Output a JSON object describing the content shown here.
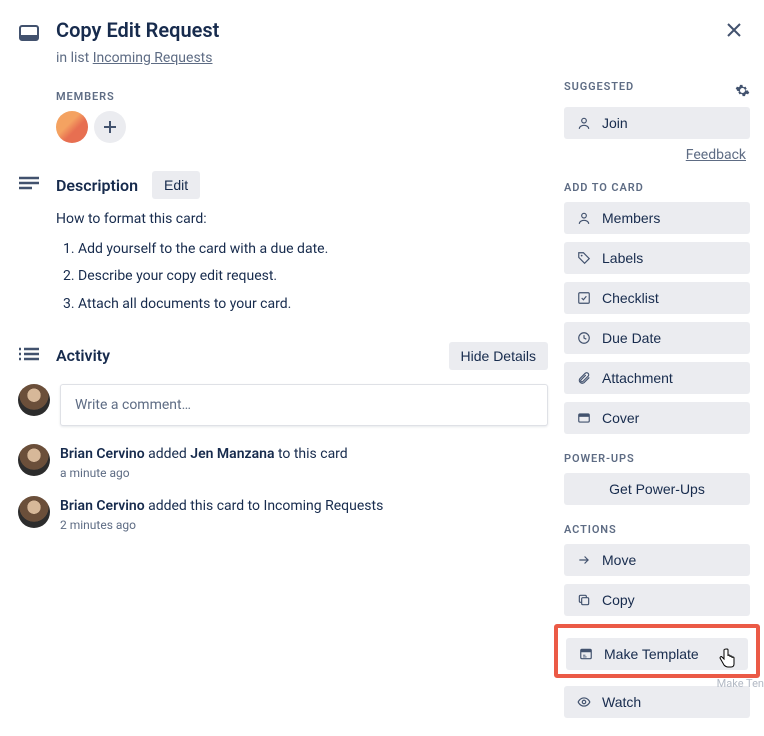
{
  "header": {
    "title": "Copy Edit Request",
    "context_prefix": "in list ",
    "list_name": "Incoming Requests"
  },
  "members": {
    "label": "MEMBERS"
  },
  "description": {
    "heading": "Description",
    "edit_label": "Edit",
    "intro": "How to format this card:",
    "steps": [
      "Add yourself to the card with a due date.",
      "Describe your copy edit request.",
      "Attach all documents to your card."
    ]
  },
  "activity": {
    "heading": "Activity",
    "hide_label": "Hide Details",
    "comment_placeholder": "Write a comment…",
    "items": [
      {
        "actor": "Brian Cervino",
        "mid": " added ",
        "target": "Jen Manzana",
        "suffix": " to this card",
        "time": "a minute ago"
      },
      {
        "actor": "Brian Cervino",
        "text": " added this card to Incoming Requests",
        "time": "2 minutes ago"
      }
    ]
  },
  "sidebar": {
    "suggested_label": "SUGGESTED",
    "join_label": "Join",
    "feedback_label": "Feedback",
    "add_to_card_label": "ADD TO CARD",
    "add_items": [
      {
        "label": "Members",
        "icon": "user"
      },
      {
        "label": "Labels",
        "icon": "tag"
      },
      {
        "label": "Checklist",
        "icon": "check"
      },
      {
        "label": "Due Date",
        "icon": "clock"
      },
      {
        "label": "Attachment",
        "icon": "attach"
      },
      {
        "label": "Cover",
        "icon": "cover"
      }
    ],
    "powerups_label": "POWER-UPS",
    "get_powerups_label": "Get Power-Ups",
    "actions_label": "ACTIONS",
    "actions": [
      {
        "label": "Move",
        "icon": "arrow"
      },
      {
        "label": "Copy",
        "icon": "copy"
      },
      {
        "label": "Make Template",
        "icon": "template",
        "highlighted": true
      },
      {
        "label": "Watch",
        "icon": "eye"
      }
    ]
  },
  "ghost": "Make Ten"
}
